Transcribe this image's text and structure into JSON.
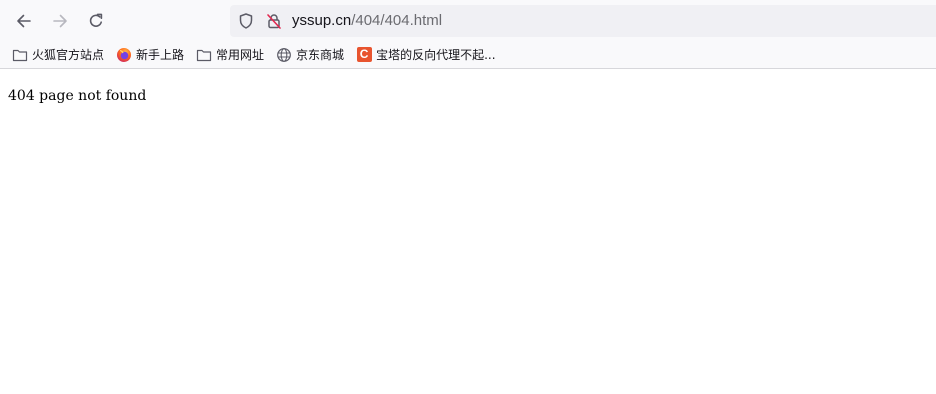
{
  "toolbar": {
    "back_icon": "arrow-left-icon",
    "forward_icon": "arrow-right-icon",
    "reload_icon": "reload-icon"
  },
  "urlbar": {
    "domain": "yssup.cn",
    "path": "/404/404.html",
    "security_icon": "shield-icon",
    "connection_icon": "insecure-lock-icon"
  },
  "bookmarks": [
    {
      "label": "火狐官方站点",
      "icon": "folder-icon"
    },
    {
      "label": "新手上路",
      "icon": "firefox-icon"
    },
    {
      "label": "常用网址",
      "icon": "folder-icon"
    },
    {
      "label": "京东商城",
      "icon": "globe-icon"
    },
    {
      "label": "宝塔的反向代理不起...",
      "icon": "c-logo-icon",
      "icon_letter": "C"
    }
  ],
  "page": {
    "text": "404 page not found"
  },
  "colors": {
    "toolbar_bg": "#f9f9fb",
    "urlbar_bg": "#f0f0f4",
    "c_badge": "#e8542f"
  }
}
